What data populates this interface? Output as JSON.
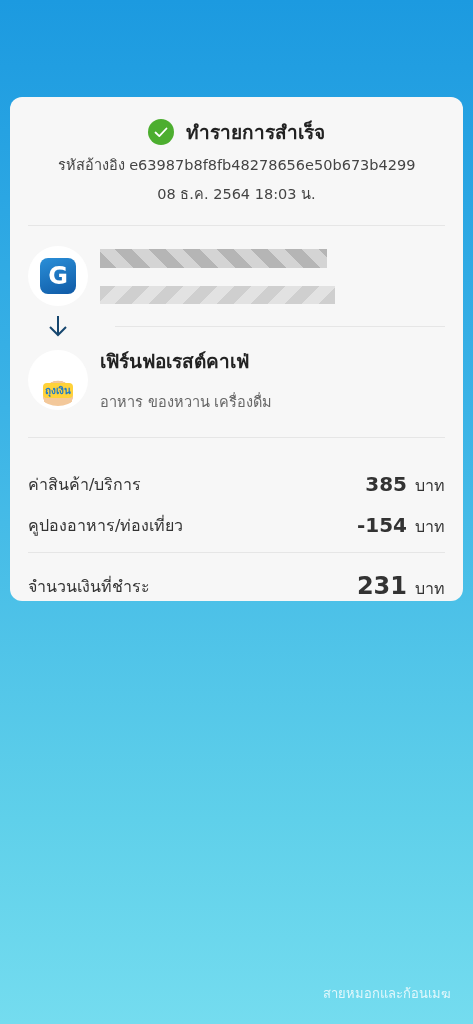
{
  "status": {
    "title": "ทำรายการสำเร็จ",
    "reference": "รหัสอ้างอิง e63987b8f8fb48278656e50b673b4299",
    "datetime": "08 ธ.ค. 2564 18:03 น."
  },
  "sender": {
    "logo_letter": "G",
    "name_redacted": true
  },
  "recipient": {
    "logo_text": "ถุงเงิน",
    "name": "เฟิร์นฟอเรสต์คาเฟ่",
    "category": "อาหาร ของหวาน เครื่องดื่ม"
  },
  "amounts": [
    {
      "kind": "item",
      "label": "ค่าสินค้า/บริการ",
      "value": "385",
      "unit": "บาท"
    },
    {
      "kind": "item",
      "label": "คูปองอาหาร/ท่องเที่ยว",
      "value": "-154",
      "unit": "บาท"
    },
    {
      "kind": "total",
      "label": "จำนวนเงินที่ชำระ",
      "value": "231",
      "unit": "บาท"
    }
  ],
  "theme_name": "สายหมอกและก้อนเมฆ"
}
